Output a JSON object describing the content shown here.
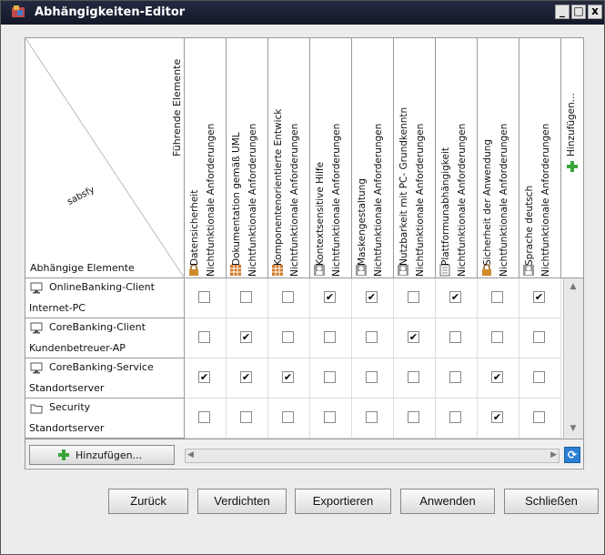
{
  "window": {
    "title": "Abhängigkeiten-Editor",
    "controls": [
      "_",
      "□",
      "x"
    ]
  },
  "corner": {
    "leading_label": "Führende Elemente",
    "sabsfy_label": "sabsfy",
    "dependent_label": "Abhängige Elemente"
  },
  "columns": [
    {
      "line1": "Datensicherheit",
      "line2": "Nichtfunktionale Anforderungen",
      "icon": "lock-icon"
    },
    {
      "line1": "Dokumentation gemäß UML",
      "line2": "Nichtfunktionale Anforderungen",
      "icon": "grid-icon"
    },
    {
      "line1": "Komponentenorientierte Entwick",
      "line2": "Nichtfunktionale Anforderungen",
      "icon": "grid-icon"
    },
    {
      "line1": "Kontextsensitive Hilfe",
      "line2": "Nichtfunktionale Anforderungen",
      "icon": "person-icon"
    },
    {
      "line1": "Maskengestaltung",
      "line2": "Nichtfunktionale Anforderungen",
      "icon": "person-icon"
    },
    {
      "line1": "Nutzbarkeit mit PC- Grundkenntn",
      "line2": "Nichtfunktionale Anforderungen",
      "icon": "person-icon"
    },
    {
      "line1": "Plattformunabhängigkeit",
      "line2": "Nichtfunktionale Anforderungen",
      "icon": "document-icon"
    },
    {
      "line1": "Sicherheit der Anwendung",
      "line2": "Nichtfunktionale Anforderungen",
      "icon": "lock-icon"
    },
    {
      "line1": "Sprache deutsch",
      "line2": "Nichtfunktionale Anforderungen",
      "icon": "person-icon"
    }
  ],
  "add_column_label": "Hinzufügen...",
  "rows": [
    {
      "name": "OnlineBanking-Client",
      "sub": "Internet-PC",
      "icon": "monitor-icon",
      "checks": [
        false,
        false,
        false,
        true,
        true,
        false,
        true,
        false,
        true
      ]
    },
    {
      "name": "CoreBanking-Client",
      "sub": "Kundenbetreuer-AP",
      "icon": "monitor-icon",
      "checks": [
        false,
        true,
        false,
        false,
        false,
        true,
        false,
        false,
        false
      ]
    },
    {
      "name": "CoreBanking-Service",
      "sub": "Standortserver",
      "icon": "monitor-icon",
      "checks": [
        true,
        true,
        true,
        false,
        false,
        false,
        false,
        true,
        false
      ]
    },
    {
      "name": "Security",
      "sub": "Standortserver",
      "icon": "folder-icon",
      "checks": [
        false,
        false,
        false,
        false,
        false,
        false,
        false,
        true,
        false
      ]
    }
  ],
  "add_row_label": "Hinzufügen...",
  "check_glyph": "✔",
  "buttons": {
    "back": "Zurück",
    "condense": "Verdichten",
    "export": "Exportieren",
    "apply": "Anwenden",
    "close": "Schließen"
  },
  "colors": {
    "titlebar": "#1a2035",
    "add_green": "#3aa63a",
    "refresh_blue": "#2a7fd4"
  }
}
